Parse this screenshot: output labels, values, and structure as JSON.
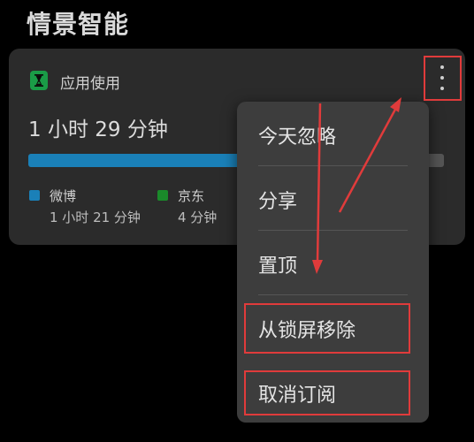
{
  "page": {
    "title": "情景智能"
  },
  "card": {
    "label": "应用使用",
    "total_time": "1 小时 29 分钟",
    "usage": [
      {
        "app": "微博",
        "time": "1 小时 21 分钟",
        "fraction": 0.91,
        "color": "#1a80b8"
      },
      {
        "app": "京东",
        "time": "4 分钟",
        "fraction": 0.05,
        "color": "#1a8a2a"
      }
    ],
    "other_fraction": 0.04,
    "icons": {
      "app_icon": "hourglass-icon",
      "more": "more-vertical-icon"
    }
  },
  "menu": {
    "items": [
      {
        "label": "今天忽略"
      },
      {
        "label": "分享"
      },
      {
        "label": "置顶"
      },
      {
        "label": "从锁屏移除"
      },
      {
        "label": "取消订阅"
      }
    ]
  },
  "annotations": {
    "highlight_color": "#e03b3b"
  }
}
